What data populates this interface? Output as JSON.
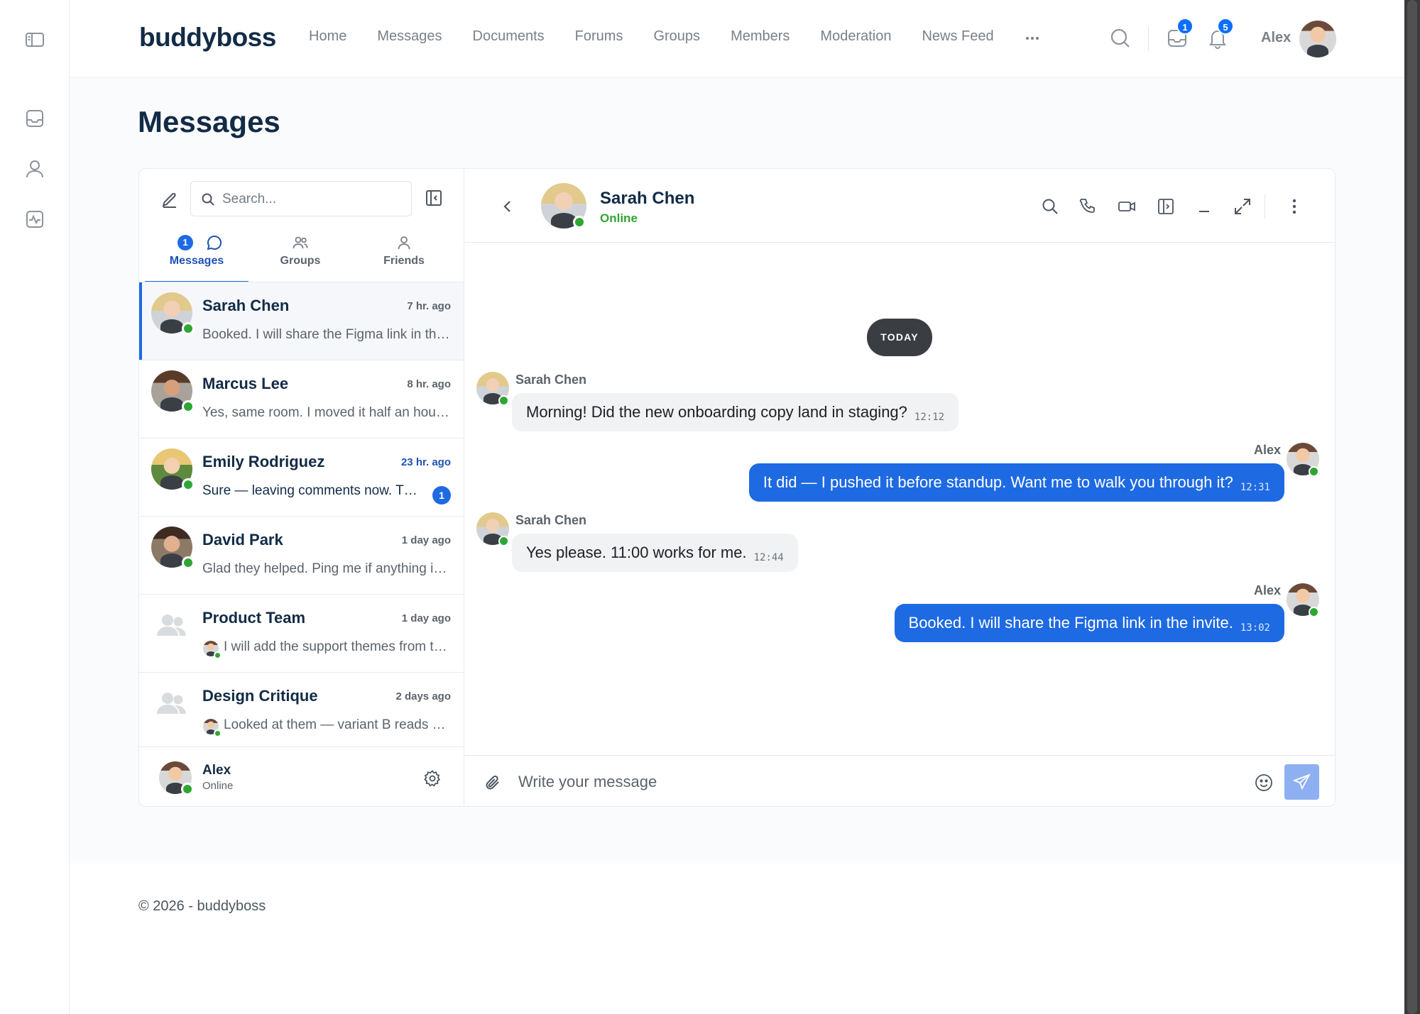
{
  "brand": {
    "logo": "buddyboss"
  },
  "nav": {
    "items": [
      "Home",
      "Messages",
      "Documents",
      "Forums",
      "Groups",
      "Members",
      "Moderation",
      "News Feed"
    ],
    "more_label": "···"
  },
  "header": {
    "messages_badge": "1",
    "notifications_badge": "5",
    "user_name": "Alex"
  },
  "page": {
    "title": "Messages"
  },
  "sidebar": {
    "search_placeholder": "Search...",
    "tabs": [
      {
        "label": "Messages",
        "badge": "1",
        "icon": "chat-bubble-icon",
        "active": true
      },
      {
        "label": "Groups",
        "icon": "users-icon",
        "active": false
      },
      {
        "label": "Friends",
        "icon": "user-icon",
        "active": false
      }
    ],
    "threads": [
      {
        "name": "Sarah Chen",
        "time": "7 hr. ago",
        "snippet": "Booked. I will share the Figma link in the invite.",
        "online": true,
        "active": true
      },
      {
        "name": "Marcus Lee",
        "time": "8 hr. ago",
        "snippet": "Yes, same room. I moved it half an hour later.",
        "online": true
      },
      {
        "name": "Emily Rodriguez",
        "time": "23 hr. ago",
        "snippet": "Sure — leaving comments now. Thanks!",
        "online": true,
        "unread": "1"
      },
      {
        "name": "David Park",
        "time": "1 day ago",
        "snippet": "Glad they helped. Ping me if anything is unclear.",
        "online": true
      },
      {
        "name": "Product Team",
        "time": "1 day ago",
        "snippet": "I will add the support themes from the survey.",
        "group": true
      },
      {
        "name": "Design Critique",
        "time": "2 days ago",
        "snippet": "Looked at them — variant B reads better.",
        "group": true
      }
    ],
    "me": {
      "name": "Alex",
      "status": "Online"
    }
  },
  "conversation": {
    "name": "Sarah Chen",
    "status": "Online",
    "date_divider": "TODAY",
    "messages": [
      {
        "sender": "Sarah Chen",
        "direction": "in",
        "text": "Morning! Did the new onboarding copy land in staging?",
        "time": "12:12"
      },
      {
        "sender": "Alex",
        "direction": "out",
        "text": "It did — I pushed it before standup. Want me to walk you through it?",
        "time": "12:31"
      },
      {
        "sender": "Sarah Chen",
        "direction": "in",
        "text": "Yes please. 11:00 works for me.",
        "time": "12:44"
      },
      {
        "sender": "Alex",
        "direction": "out",
        "text": "Booked. I will share the Figma link in the invite.",
        "time": "13:02"
      }
    ],
    "composer_placeholder": "Write your message"
  },
  "footer": {
    "copyright": "© 2026 - buddyboss"
  },
  "colors": {
    "accent": "#1e6ae3",
    "online": "#2fa633",
    "brand_text": "#122b46"
  }
}
